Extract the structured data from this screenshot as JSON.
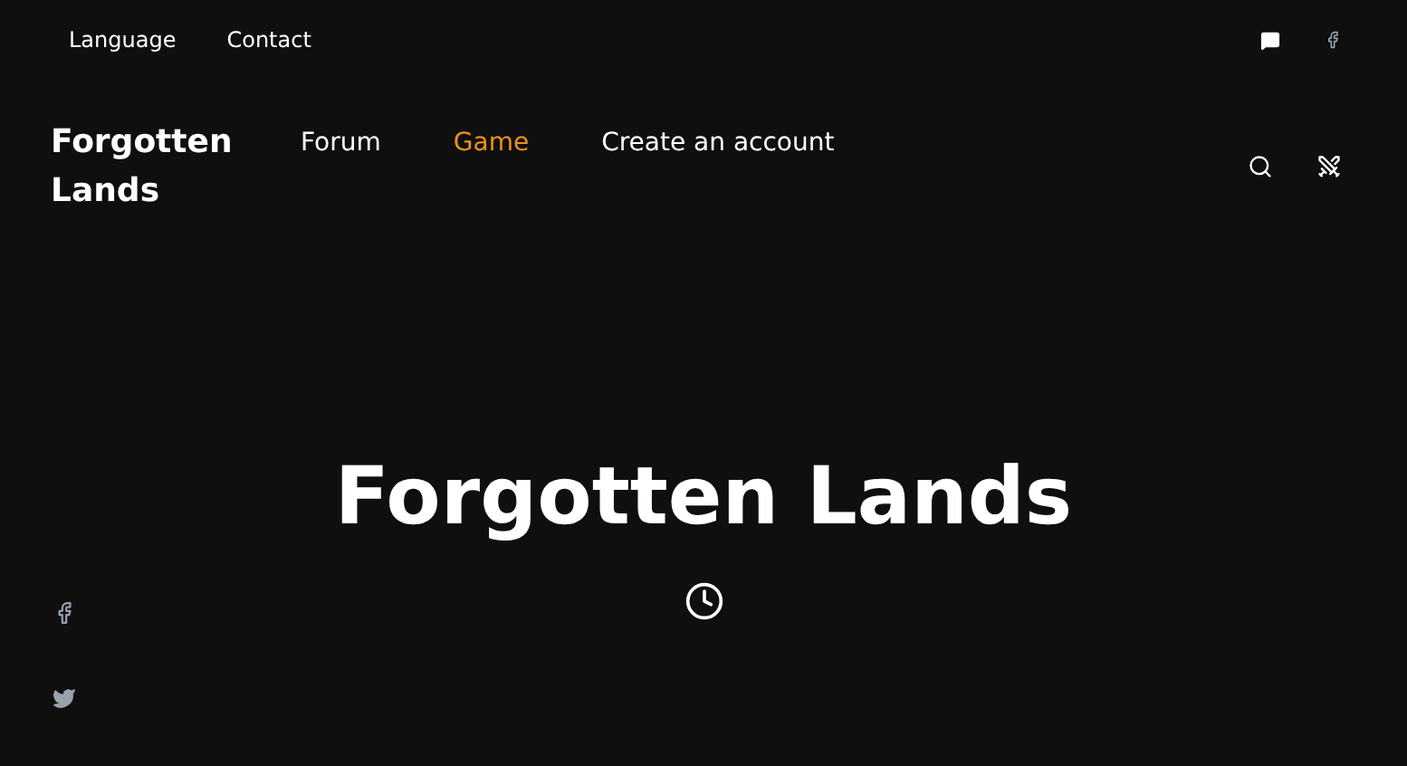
{
  "top_bar": {
    "links": [
      "Language",
      "Contact"
    ]
  },
  "header": {
    "logo": "Forgotten Lands",
    "nav": [
      {
        "label": "Forum",
        "selected": false
      },
      {
        "label": "Game",
        "selected": true
      },
      {
        "label": "Create an account",
        "selected": false
      }
    ]
  },
  "hero": {
    "title": "Forgotten Lands"
  }
}
